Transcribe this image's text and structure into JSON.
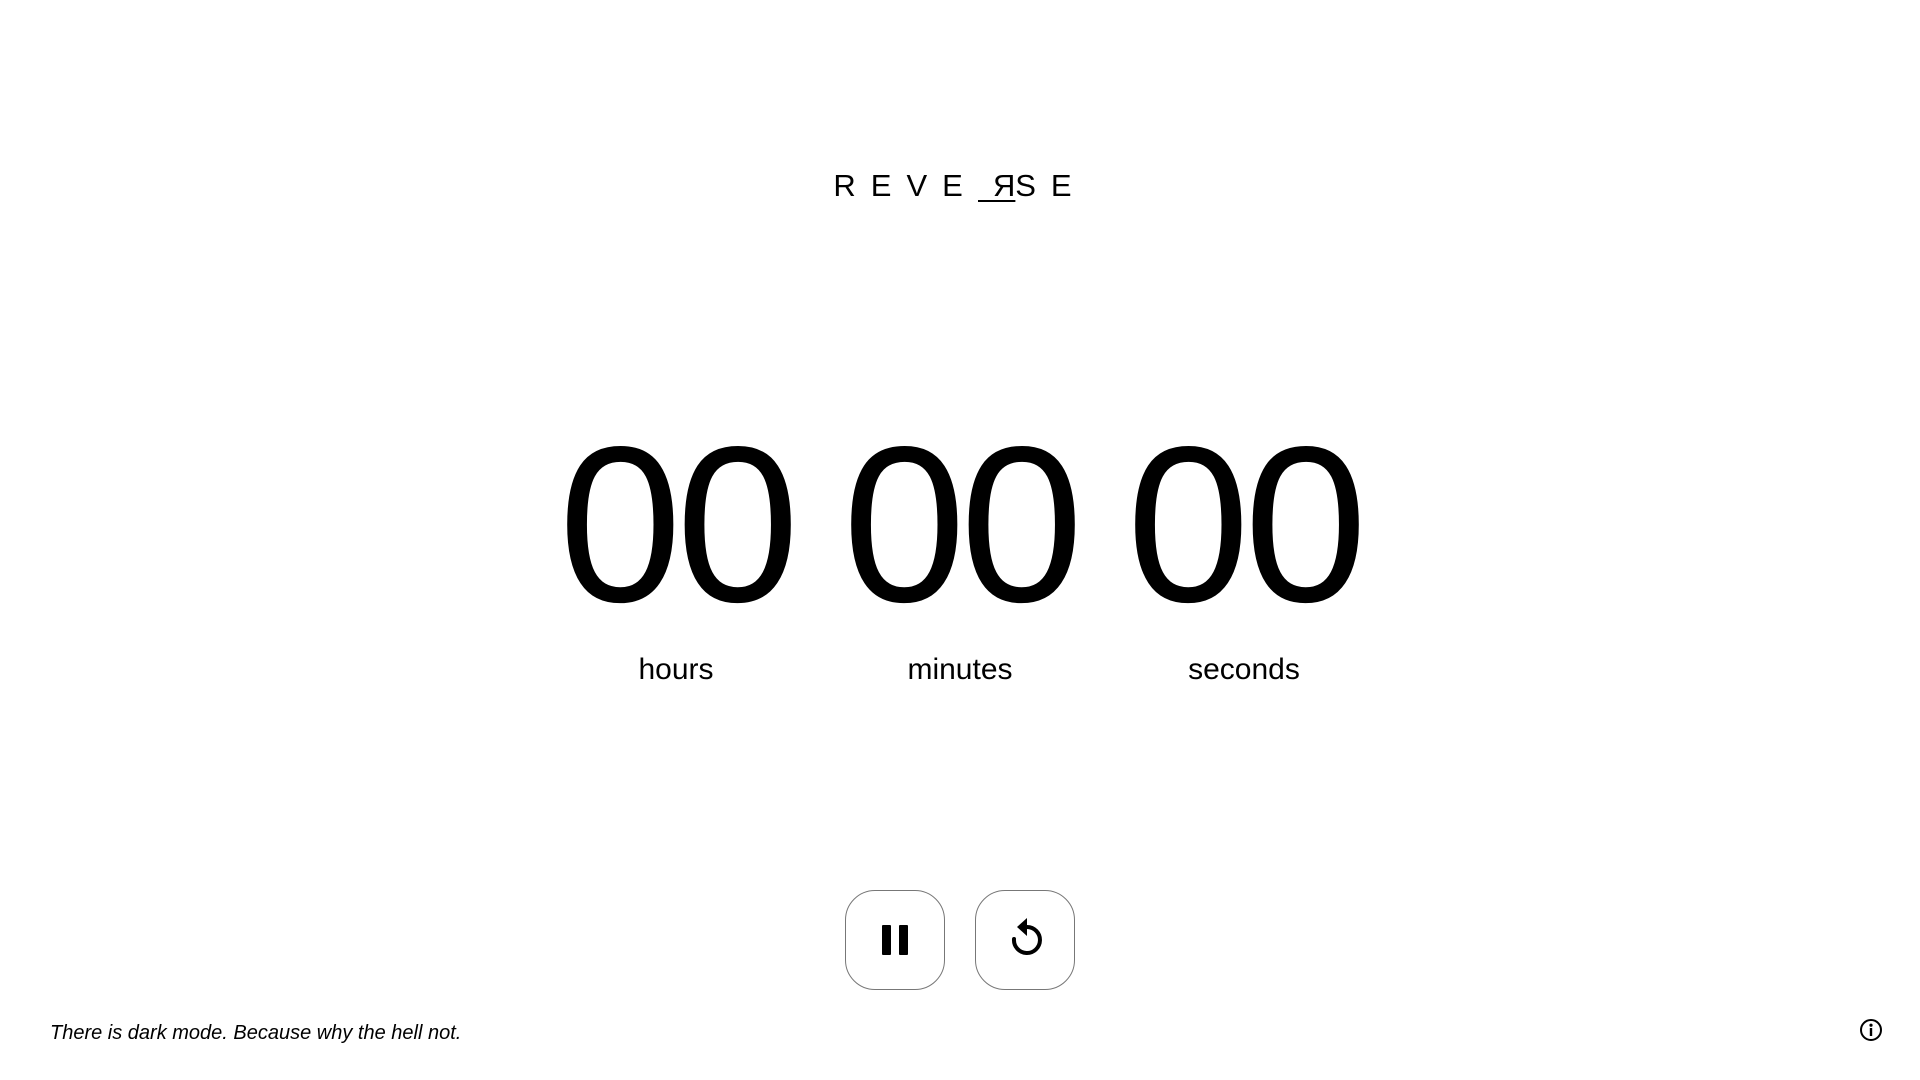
{
  "logo": {
    "prefix": "REVE",
    "mirrored": "R",
    "suffix": "SE"
  },
  "timer": {
    "hours": "00",
    "minutes": "00",
    "seconds": "00",
    "hours_label": "hours",
    "minutes_label": "minutes",
    "seconds_label": "seconds"
  },
  "controls": {
    "pause_icon": "pause-icon",
    "reset_icon": "reset-icon"
  },
  "footer": {
    "note": "There is dark mode. Because why the hell not.",
    "info_icon": "info-icon"
  },
  "colors": {
    "background": "#ffffff",
    "text": "#000000",
    "button_border": "#777777"
  }
}
